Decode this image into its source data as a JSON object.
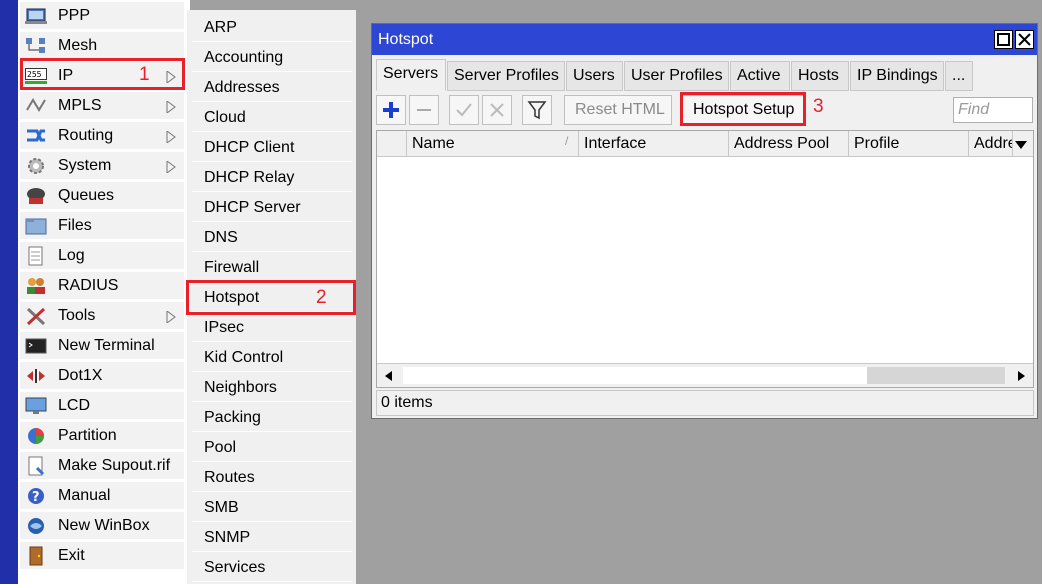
{
  "main_menu": {
    "items": [
      {
        "label": "PPP",
        "icon": "ppp-icon",
        "submenu": false
      },
      {
        "label": "Mesh",
        "icon": "mesh-icon",
        "submenu": false
      },
      {
        "label": "IP",
        "icon": "ip-icon",
        "submenu": true
      },
      {
        "label": "MPLS",
        "icon": "mpls-icon",
        "submenu": true
      },
      {
        "label": "Routing",
        "icon": "routing-icon",
        "submenu": true
      },
      {
        "label": "System",
        "icon": "system-gear-icon",
        "submenu": true
      },
      {
        "label": "Queues",
        "icon": "queues-icon",
        "submenu": false
      },
      {
        "label": "Files",
        "icon": "folder-icon",
        "submenu": false
      },
      {
        "label": "Log",
        "icon": "log-icon",
        "submenu": false
      },
      {
        "label": "RADIUS",
        "icon": "radius-users-icon",
        "submenu": false
      },
      {
        "label": "Tools",
        "icon": "tools-icon",
        "submenu": true
      },
      {
        "label": "New Terminal",
        "icon": "terminal-icon",
        "submenu": false
      },
      {
        "label": "Dot1X",
        "icon": "dot1x-icon",
        "submenu": false
      },
      {
        "label": "LCD",
        "icon": "lcd-monitor-icon",
        "submenu": false
      },
      {
        "label": "Partition",
        "icon": "partition-pie-icon",
        "submenu": false
      },
      {
        "label": "Make Supout.rif",
        "icon": "supout-file-icon",
        "submenu": false
      },
      {
        "label": "Manual",
        "icon": "help-icon",
        "submenu": false
      },
      {
        "label": "New WinBox",
        "icon": "winbox-icon",
        "submenu": false
      },
      {
        "label": "Exit",
        "icon": "exit-door-icon",
        "submenu": false
      }
    ],
    "ip_icon_text": "255"
  },
  "ip_submenu": {
    "items": [
      "ARP",
      "Accounting",
      "Addresses",
      "Cloud",
      "DHCP Client",
      "DHCP Relay",
      "DHCP Server",
      "DNS",
      "Firewall",
      "Hotspot",
      "IPsec",
      "Kid Control",
      "Neighbors",
      "Packing",
      "Pool",
      "Routes",
      "SMB",
      "SNMP",
      "Services"
    ]
  },
  "annotations": {
    "step1": "1",
    "step2": "2",
    "step3": "3",
    "color": "#e8202a"
  },
  "window": {
    "title": "Hotspot",
    "tabs": [
      "Servers",
      "Server Profiles",
      "Users",
      "User Profiles",
      "Active",
      "Hosts",
      "IP Bindings",
      "..."
    ],
    "active_tab": "Servers",
    "toolbar": {
      "reset_html": "Reset HTML",
      "hotspot_setup": "Hotspot Setup",
      "find_placeholder": "Find"
    },
    "columns": [
      "",
      "Name",
      "Interface",
      "Address Pool",
      "Profile",
      "Addre"
    ],
    "status": "0 items"
  },
  "colors": {
    "titlebar": "#2d47d4",
    "left_strip": "#2130a8",
    "background": "#a0a0a0"
  }
}
